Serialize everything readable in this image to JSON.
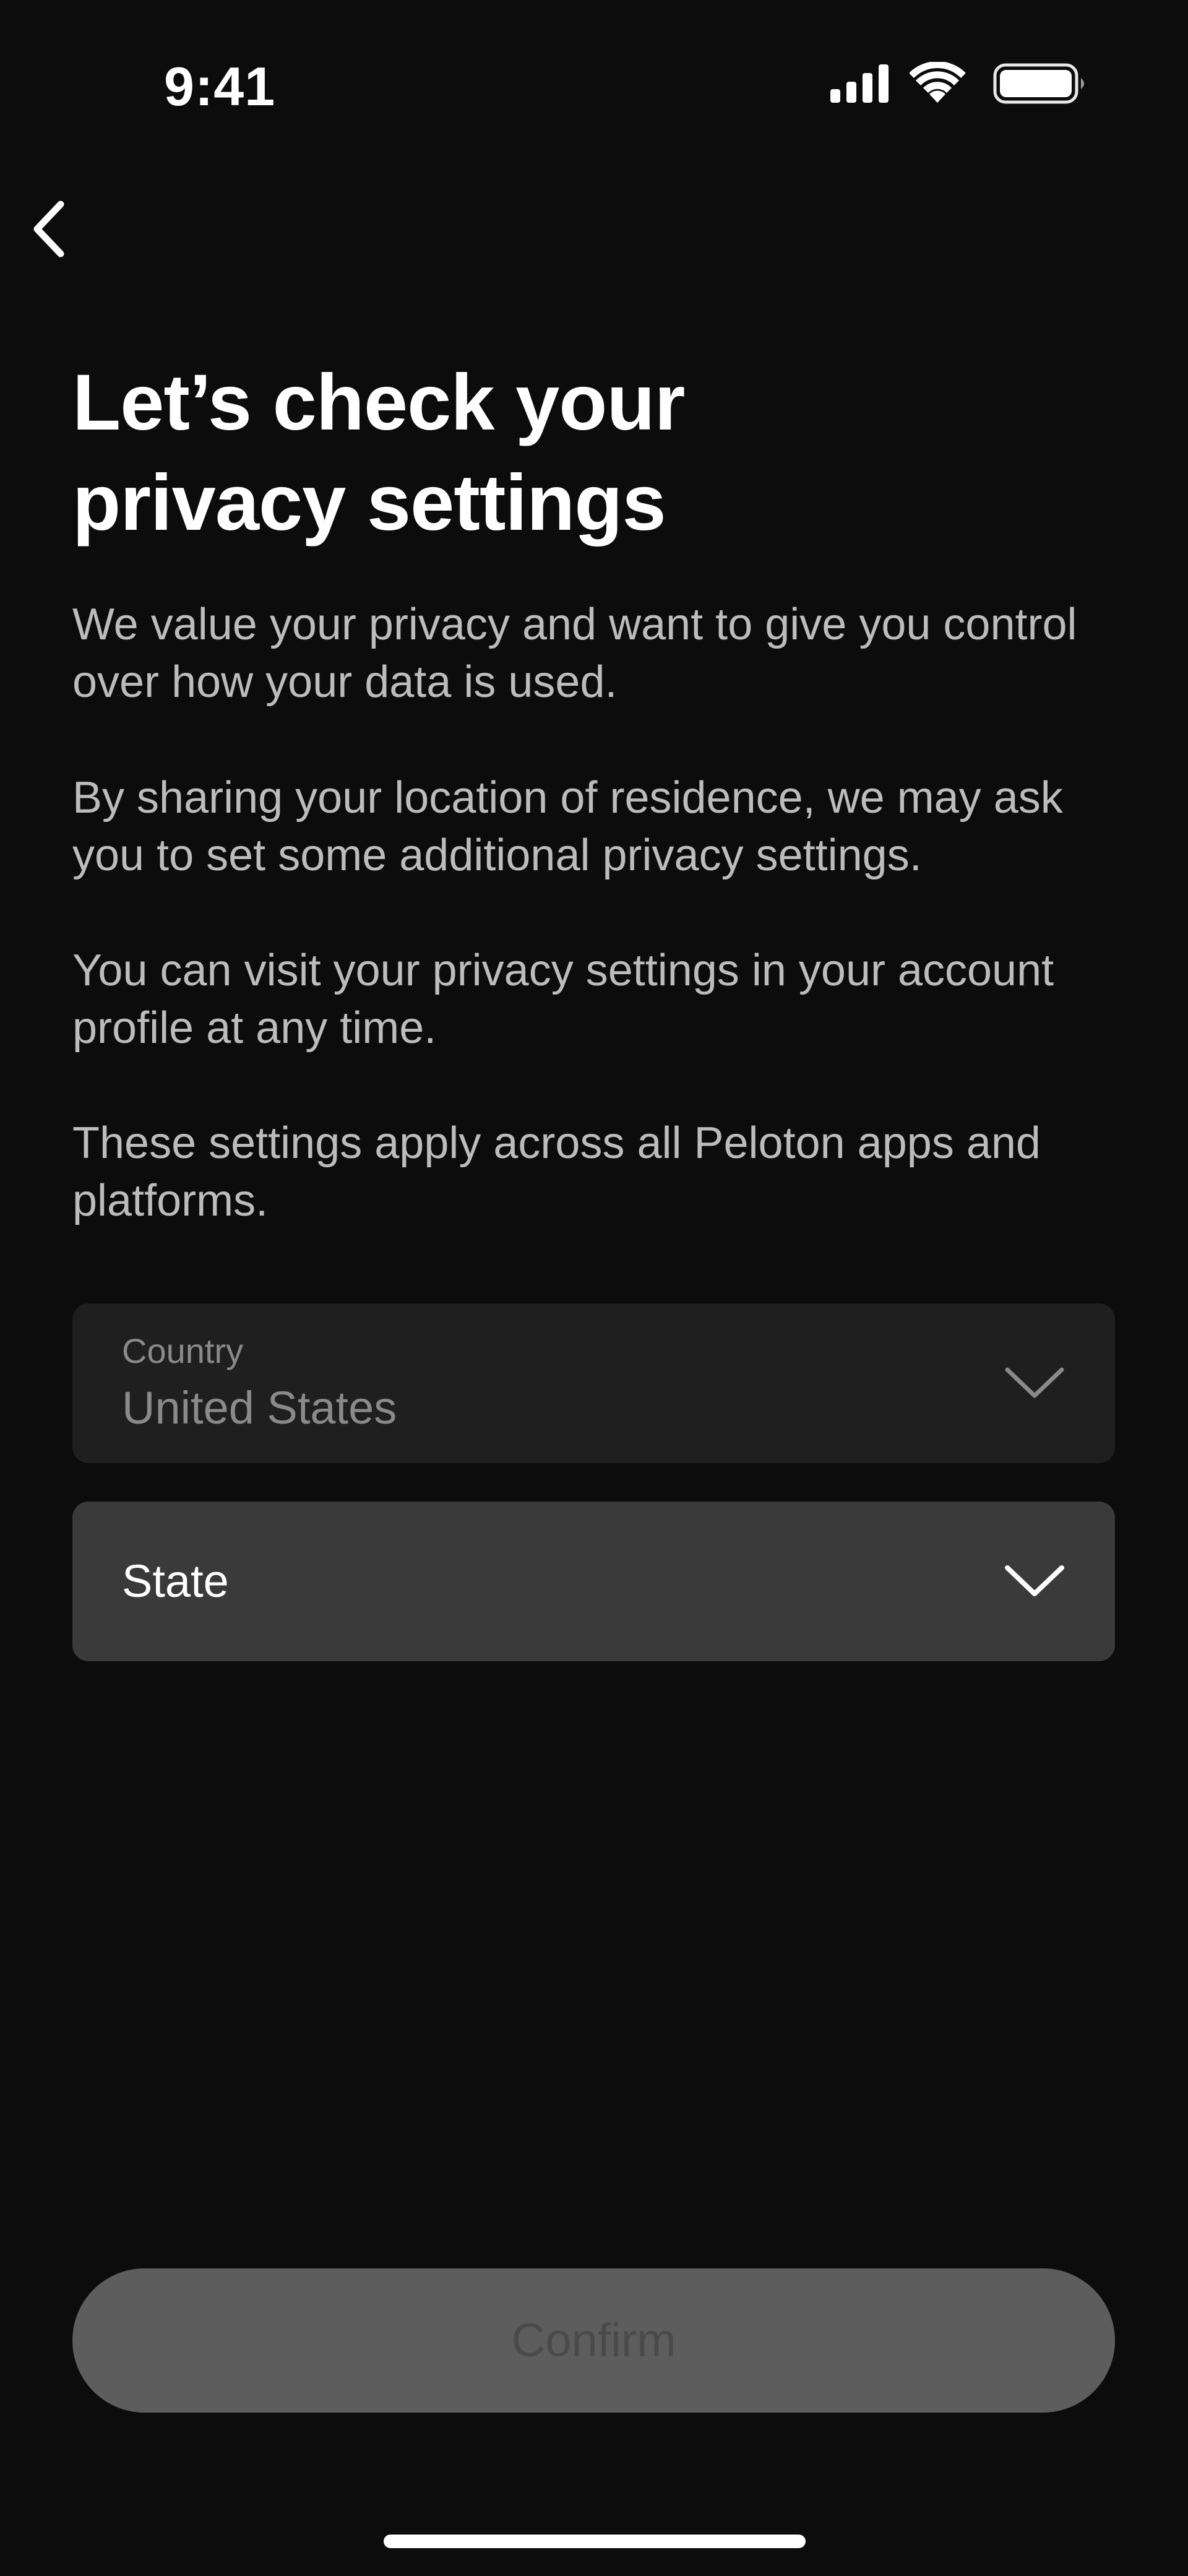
{
  "status_bar": {
    "time": "9:41",
    "icons": [
      "cellular-signal-icon",
      "wifi-icon",
      "battery-icon"
    ]
  },
  "navigation": {
    "back_icon": "chevron-left-icon"
  },
  "title": "Let’s check your\nprivacy settings",
  "paragraphs": [
    "We value your privacy and want to give you control over how your data is used.",
    "By sharing your location of residence, we may ask you to set some additional privacy settings.",
    "You can visit your privacy settings in your account profile at any time.",
    "These settings apply across all Peloton apps and platforms."
  ],
  "country_field": {
    "label": "Country",
    "value": "United States",
    "icon": "chevron-down-icon"
  },
  "state_field": {
    "placeholder": "State",
    "icon": "chevron-down-icon"
  },
  "confirm_button": {
    "label": "Confirm",
    "state": "disabled"
  },
  "colors": {
    "background": "#0c0c0c",
    "body_text": "#bcbcbc",
    "country_field_bg": "#1f1f1f",
    "state_field_bg": "#3a3a3a",
    "button_disabled_bg": "#5d5d5d",
    "button_disabled_text": "#4a4a4a"
  }
}
